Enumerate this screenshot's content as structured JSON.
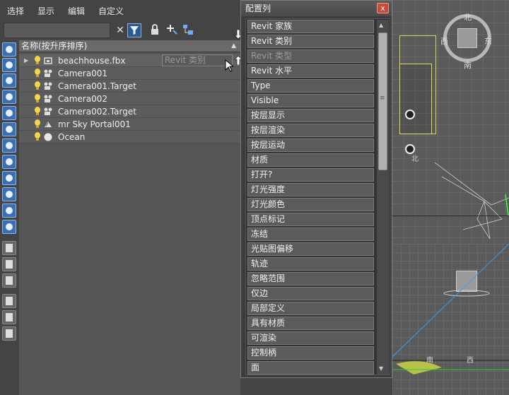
{
  "menu": {
    "items": [
      "选择",
      "显示",
      "编辑",
      "自定义"
    ]
  },
  "toolbar": {
    "search_placeholder": "",
    "clear_icon": "close-icon",
    "filter_icon": "filter-icon",
    "lock_icon": "lock-icon",
    "add_icon": "add-icon",
    "link_icon": "link-icon"
  },
  "scene_list": {
    "header": "名称(按升序排序)",
    "sort_indicator": "▲",
    "drag_ghost": "Revit 类别",
    "rows": [
      {
        "name": "beachhouse.fbx",
        "icon": "bulb-icon",
        "expandable": true
      },
      {
        "name": "Camera001",
        "icon": "bulb-icon",
        "expandable": false
      },
      {
        "name": "Camera001.Target",
        "icon": "bulb-icon",
        "expandable": false
      },
      {
        "name": "Camera002",
        "icon": "bulb-icon",
        "expandable": false
      },
      {
        "name": "Camera002.Target",
        "icon": "bulb-icon",
        "expandable": false
      },
      {
        "name": "mr Sky Portal001",
        "icon": "bulb-icon",
        "expandable": false
      },
      {
        "name": "Ocean",
        "icon": "bulb-icon",
        "expandable": false
      }
    ]
  },
  "dialog": {
    "title": "配置列",
    "close_label": "x",
    "columns": [
      {
        "label": "Revit 家族",
        "dim": false
      },
      {
        "label": "Revit 类别",
        "dim": false
      },
      {
        "label": "Revit 类型",
        "dim": true
      },
      {
        "label": "Revit 水平",
        "dim": false
      },
      {
        "label": "Type",
        "dim": false
      },
      {
        "label": "Visible",
        "dim": false
      },
      {
        "label": "按层显示",
        "dim": false
      },
      {
        "label": "按层渲染",
        "dim": false
      },
      {
        "label": "按层运动",
        "dim": false
      },
      {
        "label": "材质",
        "dim": false
      },
      {
        "label": "打开?",
        "dim": false
      },
      {
        "label": "灯光强度",
        "dim": false
      },
      {
        "label": "灯光颜色",
        "dim": false
      },
      {
        "label": "顶点标记",
        "dim": false
      },
      {
        "label": "冻结",
        "dim": false
      },
      {
        "label": "光贴图偏移",
        "dim": false
      },
      {
        "label": "轨迹",
        "dim": false
      },
      {
        "label": "忽略范围",
        "dim": false
      },
      {
        "label": "仅边",
        "dim": false
      },
      {
        "label": "局部定义",
        "dim": false
      },
      {
        "label": "具有材质",
        "dim": false
      },
      {
        "label": "可渲染",
        "dim": false
      },
      {
        "label": "控制柄",
        "dim": false
      },
      {
        "label": "面",
        "dim": false
      }
    ]
  },
  "viewport": {
    "compass_north": "北",
    "compass_south": "南",
    "compass_west": "西",
    "compass_east": "东",
    "view_north": "北",
    "bottom_south": "南",
    "bottom_west": "西"
  },
  "colors": {
    "bg": "#444444",
    "list_bg": "#555555",
    "accent_blue": "#3a6fb3",
    "bulb": "#f4d64a",
    "close_red": "#c94a3a",
    "model_yellow": "#d4d45a"
  }
}
